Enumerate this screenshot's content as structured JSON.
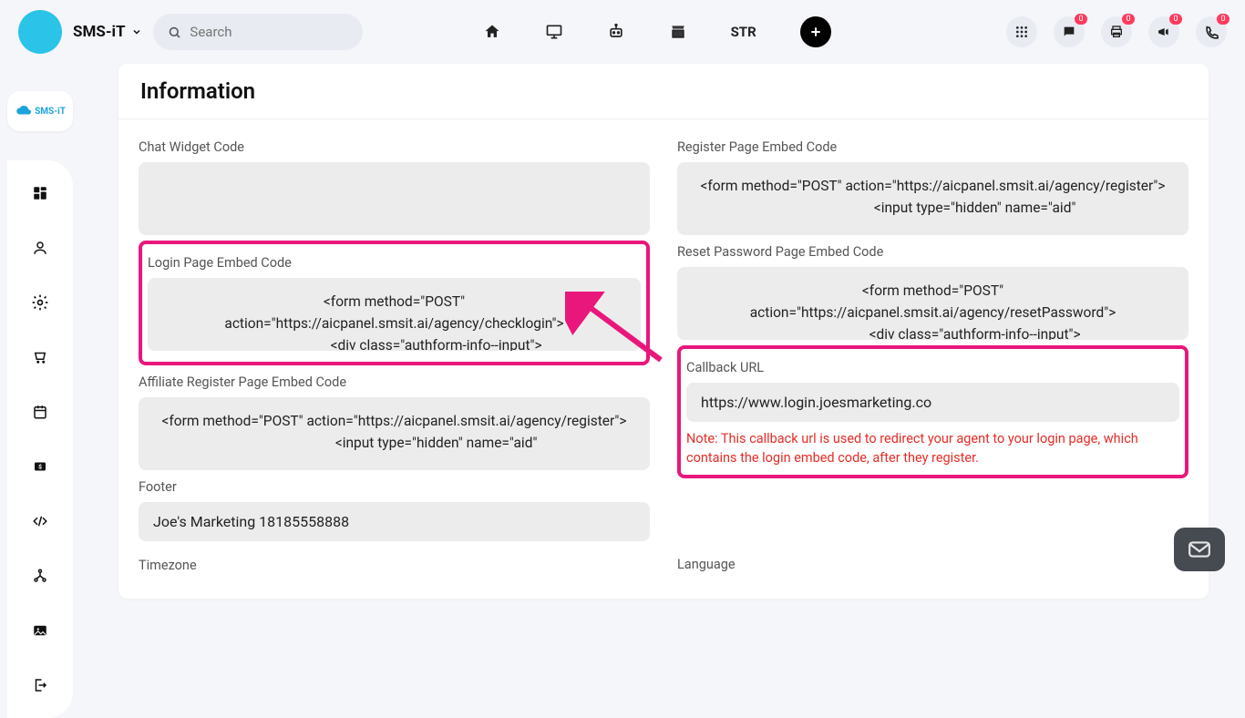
{
  "header": {
    "app_name": "SMS-iT",
    "search_placeholder": "Search",
    "str_label": "STR",
    "badges": {
      "chat": "0",
      "print": "0",
      "horn": "0",
      "phone": "0"
    }
  },
  "sidebar": {
    "logo_text": "SMS-iT"
  },
  "card": {
    "title": "Information",
    "chat_widget_label": "Chat Widget Code",
    "chat_widget_value": "",
    "register_label": "Register Page Embed Code",
    "register_value": "<form method=\"POST\" action=\"https://aicpanel.smsit.ai/agency/register\">\n                        <input type=\"hidden\" name=\"aid\"",
    "login_label": "Login Page Embed Code",
    "login_value": "<form method=\"POST\" action=\"https://aicpanel.smsit.ai/agency/checklogin\">\n                        <div class=\"authform-info--input\">",
    "reset_label": "Reset Password Page Embed Code",
    "reset_value": "<form method=\"POST\" action=\"https://aicpanel.smsit.ai/agency/resetPassword\">\n                        <div class=\"authform-info--input\">",
    "affiliate_label": "Affiliate Register Page Embed Code",
    "affiliate_value": "<form method=\"POST\" action=\"https://aicpanel.smsit.ai/agency/register\">\n                        <input type=\"hidden\" name=\"aid\"",
    "callback_label": "Callback URL",
    "callback_value": "https://www.login.joesmarketing.co",
    "callback_note": "Note: This callback url is used to redirect your agent to your login page, which contains the login embed code, after they register.",
    "footer_label": "Footer",
    "footer_value": "Joe's Marketing 18185558888",
    "timezone_label": "Timezone",
    "language_label": "Language"
  }
}
